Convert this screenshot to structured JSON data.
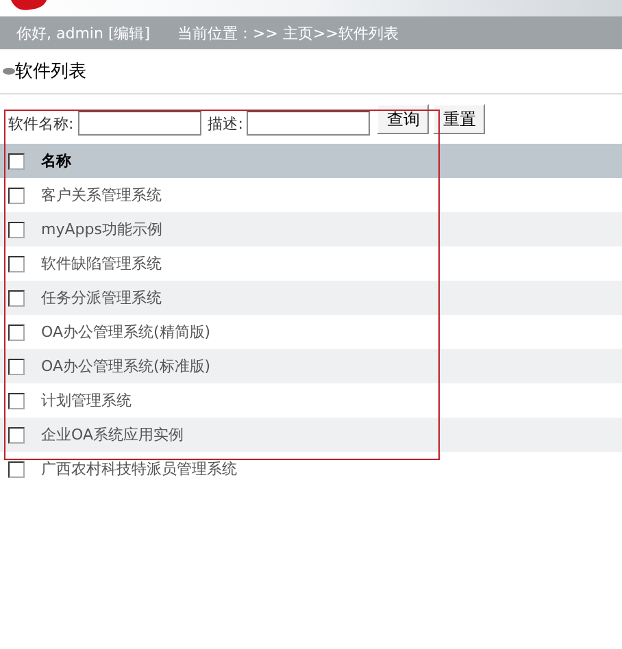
{
  "nav": {
    "greeting": "你好, admin [编辑]",
    "location": "当前位置：>> 主页>>软件列表"
  },
  "page_title": "软件列表",
  "search": {
    "fields": [
      {
        "label": "软件名称:"
      },
      {
        "label": "描述:"
      }
    ],
    "buttons": [
      "查询",
      "重置"
    ]
  },
  "table": {
    "header": {
      "label": "名称",
      "checked": false
    },
    "rows": [
      {
        "name": "客户关系管理系统",
        "checked": false
      },
      {
        "name": "myApps功能示例",
        "checked": false
      },
      {
        "name": "软件缺陷管理系统",
        "checked": false
      },
      {
        "name": "任务分派管理系统",
        "checked": false
      },
      {
        "name": "OA办公管理系统(精简版)",
        "checked": false
      },
      {
        "name": "OA办公管理系统(标准版)",
        "checked": false
      },
      {
        "name": "计划管理系统",
        "checked": false
      },
      {
        "name": "企业OA系统应用实例",
        "checked": false
      },
      {
        "name": "广西农村科技特派员管理系统",
        "checked": false
      }
    ]
  }
}
